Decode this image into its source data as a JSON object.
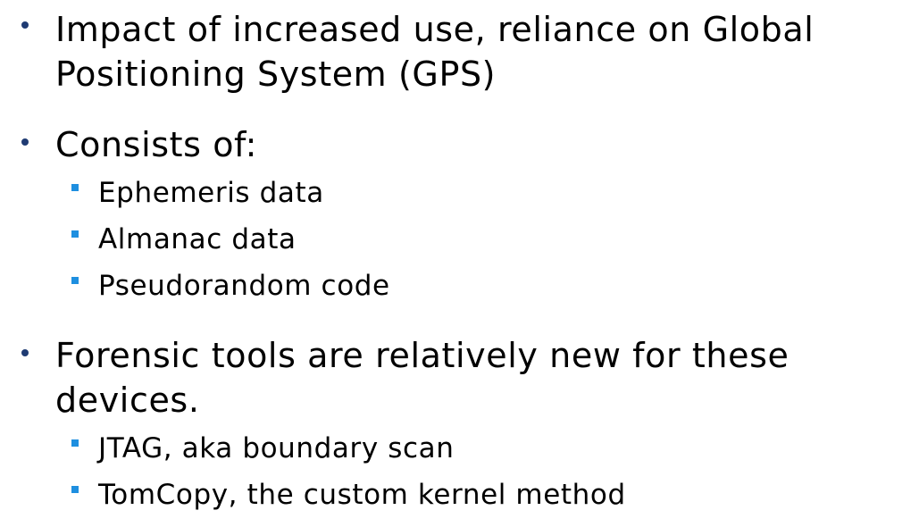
{
  "bullets": [
    {
      "text": "Impact of increased use, reliance on Global Positioning System (GPS)",
      "subitems": []
    },
    {
      "text": "Consists of:",
      "subitems": [
        "Ephemeris data",
        "Almanac data",
        "Pseudorandom code"
      ]
    },
    {
      "text": "Forensic tools are relatively new for these devices.",
      "subitems": [
        "JTAG, aka boundary scan",
        "TomCopy, the custom kernel method"
      ]
    }
  ]
}
